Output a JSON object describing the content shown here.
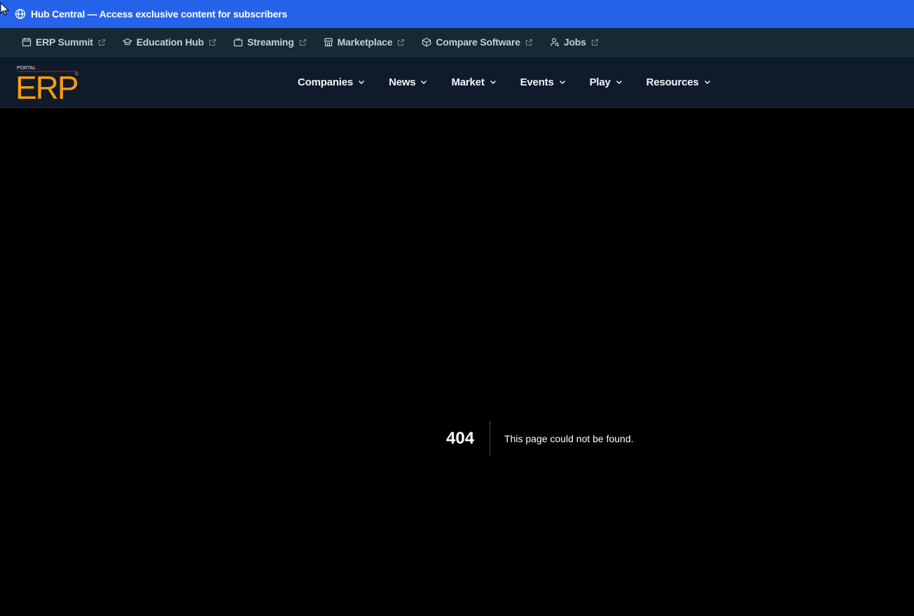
{
  "banner": {
    "text": "Hub Central — Access exclusive content for subscribers",
    "icon": "globe-icon"
  },
  "utility_links": [
    {
      "label": "ERP Summit",
      "icon": "calendar-icon"
    },
    {
      "label": "Education Hub",
      "icon": "graduation-cap-icon"
    },
    {
      "label": "Streaming",
      "icon": "tv-icon"
    },
    {
      "label": "Marketplace",
      "icon": "store-icon"
    },
    {
      "label": "Compare Software",
      "icon": "box-icon"
    },
    {
      "label": "Jobs",
      "icon": "user-search-icon"
    }
  ],
  "logo": {
    "small_text": "PORTAL",
    "main_text": "ERP",
    "mark": "®"
  },
  "nav": [
    {
      "label": "Companies"
    },
    {
      "label": "News"
    },
    {
      "label": "Market"
    },
    {
      "label": "Events"
    },
    {
      "label": "Play"
    },
    {
      "label": "Resources"
    }
  ],
  "error": {
    "code": "404",
    "message": "This page could not be found."
  },
  "colors": {
    "banner_bg": "#2563eb",
    "util_bg": "#172a33",
    "nav_bg": "#0f1a2b",
    "logo_orange": "#f59e0b",
    "page_bg": "#000000"
  }
}
